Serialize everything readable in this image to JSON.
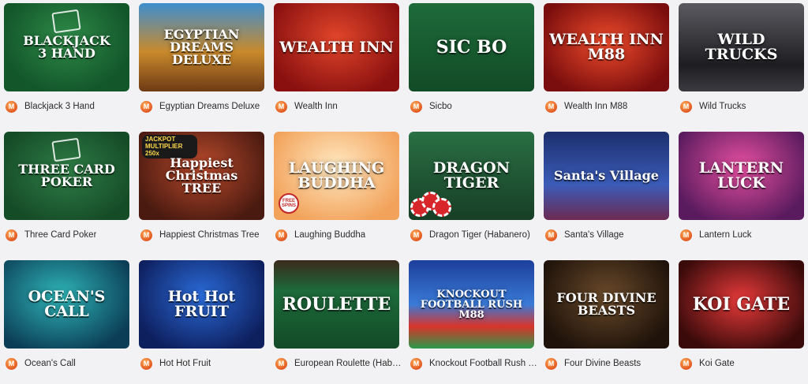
{
  "provider_icon_letter": "M",
  "games": [
    {
      "name": "Blackjack 3 Hand",
      "art": "BLACKJACK\n3 HAND",
      "theme": "t-green",
      "icon": "blackjack-game-icon"
    },
    {
      "name": "Egyptian Dreams Deluxe",
      "art": "EGYPTIAN DREAMS\nDELUXE",
      "theme": "t-egypt",
      "icon": "egyptian-dreams-game-icon"
    },
    {
      "name": "Wealth Inn",
      "art": "WEALTH INN",
      "theme": "t-wealth",
      "icon": "wealth-inn-game-icon"
    },
    {
      "name": "Sicbo",
      "art": "SIC BO",
      "theme": "t-sicbo",
      "icon": "sicbo-game-icon"
    },
    {
      "name": "Wealth Inn M88",
      "art": "WEALTH INN\nM88",
      "theme": "t-wealth88",
      "icon": "wealth-inn-m88-game-icon"
    },
    {
      "name": "Wild Trucks",
      "art": "WILD\nTRUCKS",
      "theme": "t-trucks",
      "icon": "wild-trucks-game-icon"
    },
    {
      "name": "Three Card Poker",
      "art": "THREE CARD\nPOKER",
      "theme": "t-poker",
      "icon": "three-card-poker-game-icon"
    },
    {
      "name": "Happiest Christmas Tree",
      "art": "Happiest Christmas\nTREE",
      "theme": "t-xmas",
      "icon": "christmas-tree-game-icon"
    },
    {
      "name": "Laughing Buddha",
      "art": "LAUGHING\nBUDDHA",
      "theme": "t-buddha",
      "icon": "laughing-buddha-game-icon"
    },
    {
      "name": "Dragon Tiger (Habanero)",
      "art": "DRAGON\nTIGER",
      "theme": "t-dragon",
      "icon": "dragon-tiger-game-icon"
    },
    {
      "name": "Santa's Village",
      "art": "Santa's Village",
      "theme": "t-santa",
      "icon": "santas-village-game-icon"
    },
    {
      "name": "Lantern Luck",
      "art": "LANTERN\nLUCK",
      "theme": "t-lantern",
      "icon": "lantern-luck-game-icon"
    },
    {
      "name": "Ocean's Call",
      "art": "OCEAN'S CALL",
      "theme": "t-ocean",
      "icon": "oceans-call-game-icon"
    },
    {
      "name": "Hot Hot Fruit",
      "art": "Hot Hot\nFRUIT",
      "theme": "t-hothot",
      "icon": "hot-hot-fruit-game-icon"
    },
    {
      "name": "European Roulette (Haban…",
      "art": "ROULETTE",
      "theme": "t-roulette",
      "icon": "european-roulette-game-icon"
    },
    {
      "name": "Knockout Football Rush M…",
      "art": "KNOCKOUT\nFOOTBALL RUSH\nM88",
      "theme": "t-knockout",
      "icon": "knockout-football-game-icon"
    },
    {
      "name": "Four Divine Beasts",
      "art": "FOUR DIVINE\nBEASTS",
      "theme": "t-beasts",
      "icon": "four-divine-beasts-game-icon"
    },
    {
      "name": "Koi Gate",
      "art": "KOI GATE",
      "theme": "t-koi",
      "icon": "koi-gate-game-icon"
    }
  ],
  "badges": {
    "jackpot_multiplier": "JACKPOT MULTIPLIER 250x",
    "free_spins": "FREE SPINS"
  }
}
